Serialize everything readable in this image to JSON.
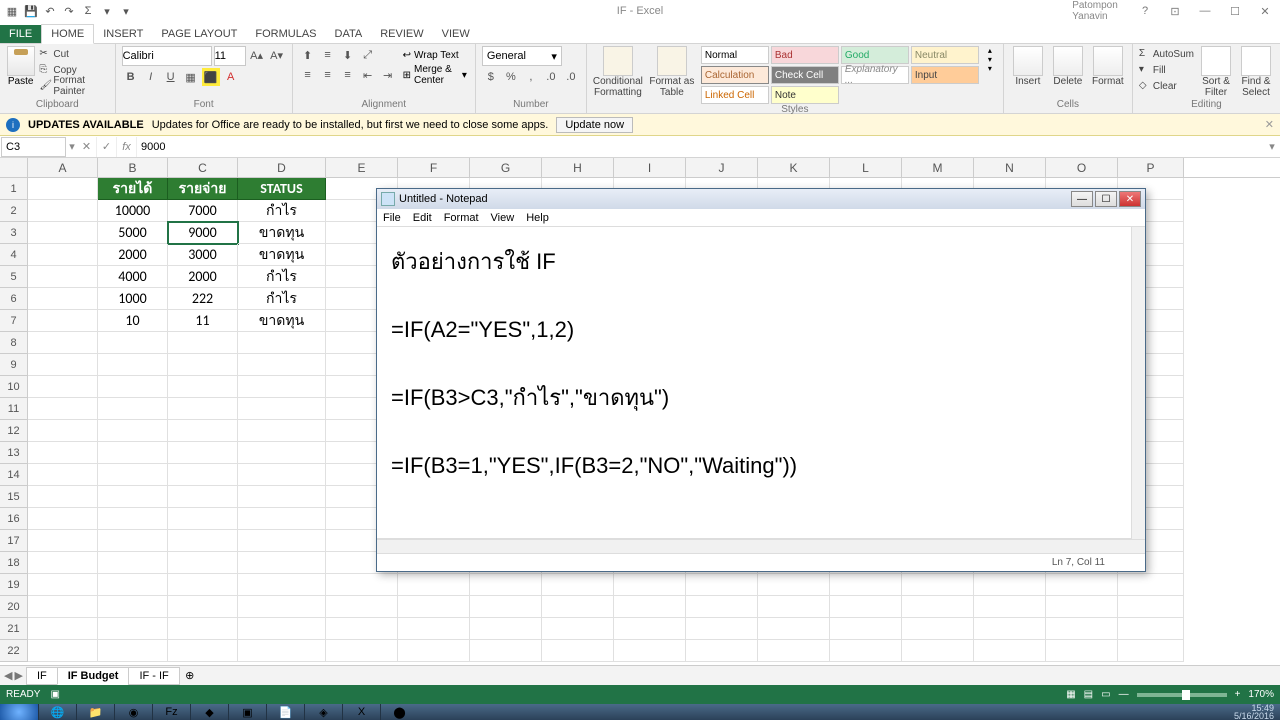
{
  "titlebar": {
    "doc": "IF - Excel",
    "user": "Patompon Yanavin"
  },
  "tabs": [
    "FILE",
    "HOME",
    "INSERT",
    "PAGE LAYOUT",
    "FORMULAS",
    "DATA",
    "REVIEW",
    "VIEW"
  ],
  "clipboard": {
    "paste": "Paste",
    "cut": "Cut",
    "copy": "Copy",
    "painter": "Format Painter",
    "label": "Clipboard"
  },
  "font": {
    "name": "Calibri",
    "size": "11",
    "label": "Font"
  },
  "align": {
    "wrap": "Wrap Text",
    "merge": "Merge & Center",
    "label": "Alignment"
  },
  "number": {
    "format": "General",
    "label": "Number"
  },
  "styles": {
    "cond": "Conditional Formatting",
    "fmtTable": "Format as Table",
    "cells": [
      {
        "t": "Normal",
        "bg": "#ffffff",
        "c": "#000"
      },
      {
        "t": "Bad",
        "bg": "#f8d7da",
        "c": "#a33"
      },
      {
        "t": "Good",
        "bg": "#d4edda",
        "c": "#2a6"
      },
      {
        "t": "Neutral",
        "bg": "#fff3cd",
        "c": "#886"
      },
      {
        "t": "Calculation",
        "bg": "#fde9d9",
        "c": "#a63",
        "b": 1
      },
      {
        "t": "Check Cell",
        "bg": "#808080",
        "c": "#fff"
      },
      {
        "t": "Explanatory ...",
        "bg": "#fff",
        "c": "#888",
        "i": 1
      },
      {
        "t": "Input",
        "bg": "#ffcc99",
        "c": "#444"
      },
      {
        "t": "Linked Cell",
        "bg": "#fff",
        "c": "#c60"
      },
      {
        "t": "Note",
        "bg": "#ffffcc",
        "c": "#333"
      }
    ],
    "label": "Styles"
  },
  "cellsGroup": {
    "insert": "Insert",
    "delete": "Delete",
    "format": "Format",
    "label": "Cells"
  },
  "editing": {
    "sum": "AutoSum",
    "fill": "Fill",
    "clear": "Clear",
    "sort": "Sort & Filter",
    "find": "Find & Select",
    "label": "Editing"
  },
  "update": {
    "title": "UPDATES AVAILABLE",
    "msg": "Updates for Office are ready to be installed, but first we need to close some apps.",
    "btn": "Update now"
  },
  "namebox": "C3",
  "formula": "9000",
  "cols": [
    "A",
    "B",
    "C",
    "D",
    "E",
    "F",
    "G",
    "H",
    "I",
    "J",
    "K",
    "L",
    "M",
    "N",
    "O",
    "P"
  ],
  "headers": {
    "b": "รายได้",
    "c": "รายจ่าย",
    "d": "STATUS"
  },
  "rows": [
    {
      "b": "10000",
      "c": "7000",
      "d": "กำไร"
    },
    {
      "b": "5000",
      "c": "9000",
      "d": "ขาดทุน"
    },
    {
      "b": "2000",
      "c": "3000",
      "d": "ขาดทุน"
    },
    {
      "b": "4000",
      "c": "2000",
      "d": "กำไร"
    },
    {
      "b": "1000",
      "c": "222",
      "d": "กำไร"
    },
    {
      "b": "10",
      "c": "11",
      "d": "ขาดทุน"
    }
  ],
  "sheets": [
    "IF",
    "IF Budget",
    "IF - IF"
  ],
  "status": {
    "ready": "READY",
    "zoom": "170%"
  },
  "notepad": {
    "title": "Untitled - Notepad",
    "menu": [
      "File",
      "Edit",
      "Format",
      "View",
      "Help"
    ],
    "line1": "ตัวอย่างการใช้ IF",
    "line2": "=IF(A2=\"YES\",1,2)",
    "line3": "=IF(B3>C3,\"กำไร\",\"ขาดทุน\")",
    "line4": "=IF(B3=1,\"YES\",IF(B3=2,\"NO\",\"Waiting\"))",
    "status": "Ln 7, Col 11"
  },
  "tray": {
    "time": "15:49",
    "date": "5/16/2016"
  }
}
